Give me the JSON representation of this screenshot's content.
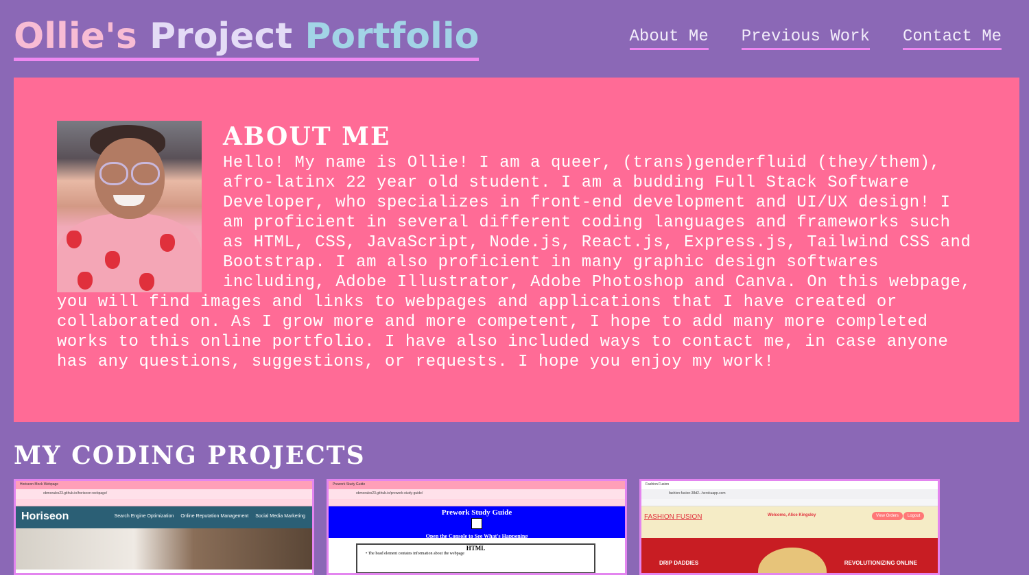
{
  "header": {
    "title_part1": "Ollie's",
    "title_part2": "Project",
    "title_part3": "Portfolio",
    "nav": [
      "About Me",
      "Previous Work",
      "Contact Me"
    ]
  },
  "about": {
    "heading": "ABOUT ME",
    "body": "Hello! My name is Ollie! I am a queer, (trans)genderfluid (they/them), afro-latinx 22 year old student. I am a budding Full Stack Software Developer, who specializes in front-end development and UI/UX design! I am proficient in several different coding languages and frameworks such as HTML, CSS, JavaScript, Node.js, React.js, Express.js, Tailwind CSS and Bootstrap. I am also proficient in many graphic design softwares including, Adobe Illustrator, Adobe Photoshop and Canva. On this webpage, you will find images and links to webpages and applications that I have created or collaborated on. As I grow more and more competent, I hope to add many more completed works to this online portfolio. I have also included ways to contact me, in case anyone has any questions, suggestions, or requests. I hope you enjoy my work!"
  },
  "projects": {
    "heading": "MY CODING PROJECTS",
    "card1": {
      "tab": "Horiseon Mock Webpage",
      "url": "obmorales23.github.io/horiseon-webpage/",
      "logo": "Horiseon",
      "links": [
        "Search Engine Optimization",
        "Online Reputation Management",
        "Social Media Marketing"
      ]
    },
    "card2": {
      "tab": "Prework Study Guide",
      "url": "obmorales23.github.io/prework-study-guide/",
      "title": "Prework Study Guide",
      "subtitle": "Open the Console to See What's Happening",
      "box_title": "HTML",
      "box_item": "• The head element contains information about the webpage"
    },
    "card3": {
      "tab": "Fashion Fusion",
      "url": "fashion-fusion-38d2...herokuapp.com",
      "logo": "FASHION FUSION",
      "welcome": "Welcome, Alice Kingsley",
      "btn1": "View Orders",
      "btn2": "Logout",
      "banner_left": "DRIP DADDIES",
      "banner_right": "REVOLUTIONIZING ONLINE"
    }
  },
  "colors": {
    "background": "#8b68b6",
    "about_bg": "#ff6b96",
    "accent_underline": "#ee88f0"
  }
}
